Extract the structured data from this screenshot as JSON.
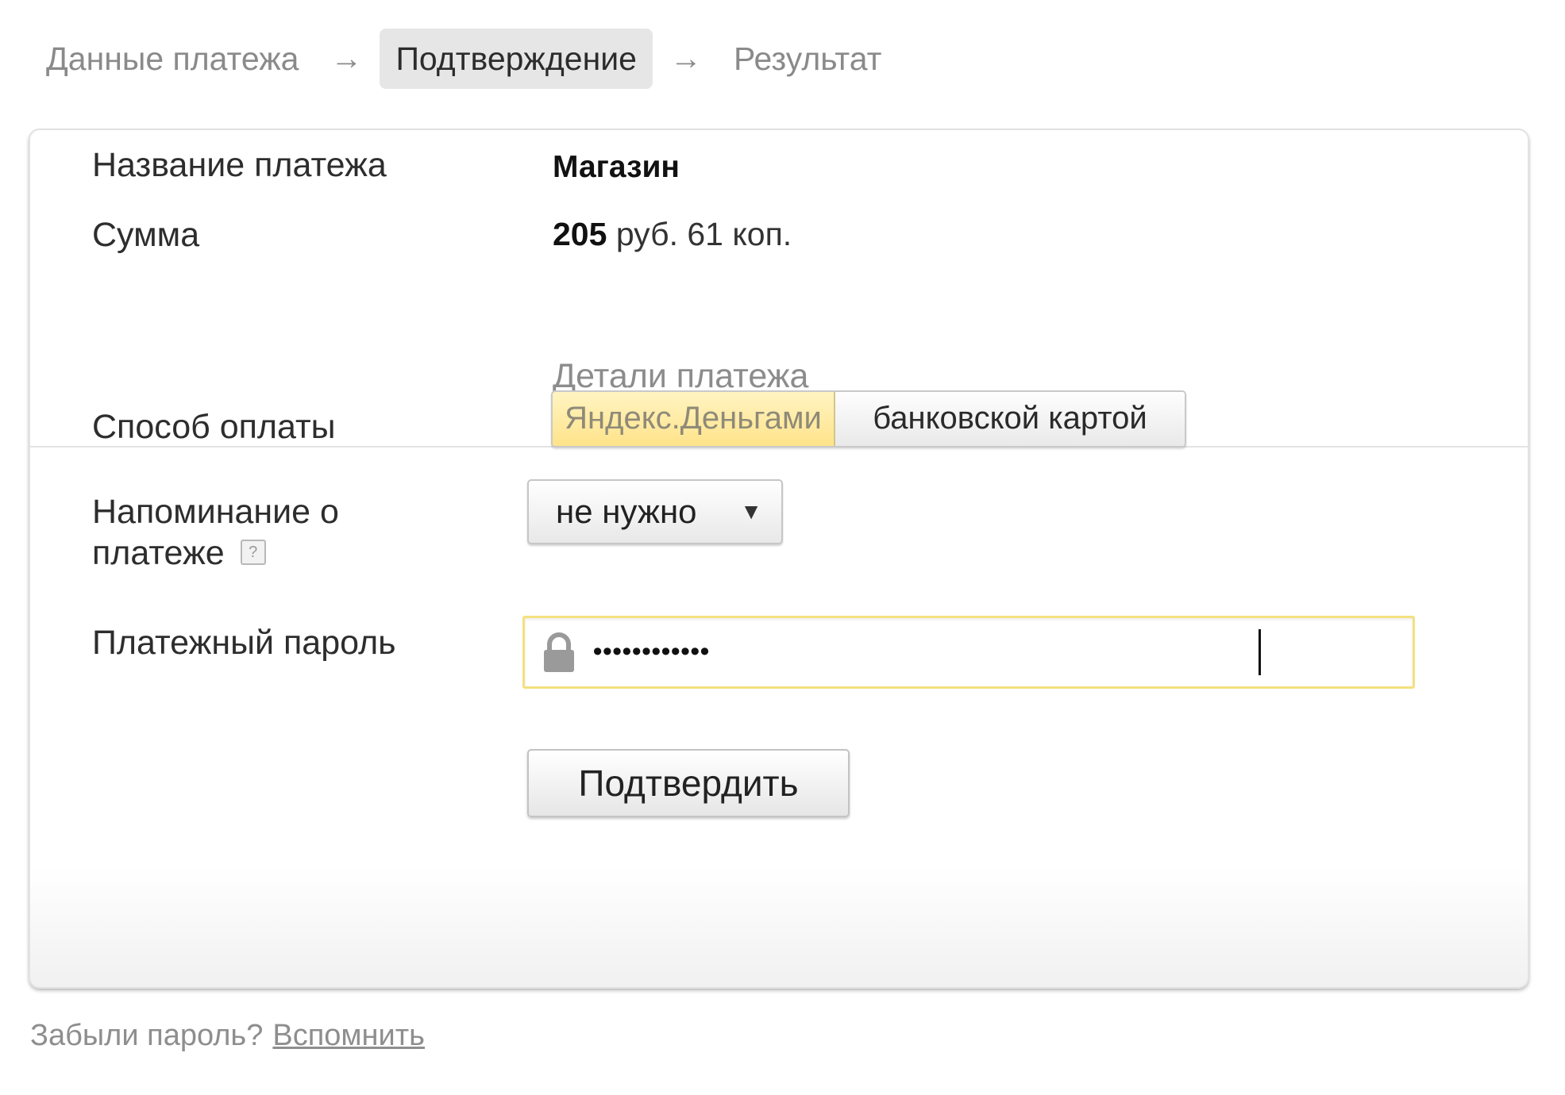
{
  "breadcrumb": {
    "step1": "Данные платежа",
    "arrow": "→",
    "step2": "Подтверждение",
    "step3": "Результат"
  },
  "payment": {
    "name_label": "Название платежа",
    "name_value": "Магазин",
    "sum_label": "Сумма",
    "sum_main": "205",
    "sum_rest": " руб. 61 коп.",
    "details_link": "Детали платежа"
  },
  "form": {
    "method_label": "Способ оплаты",
    "method_options": [
      "Яндекс.Деньгами",
      "банковской картой"
    ],
    "method_selected": "Яндекс.Деньгами",
    "reminder_label_line1": "Напоминание о",
    "reminder_label_line2": "платеже",
    "reminder_help": "?",
    "reminder_value": "не нужно",
    "reminder_arrow": "▼",
    "password_label": "Платежный пароль",
    "password_value": "••••••••••••",
    "submit_label": "Подтвердить"
  },
  "footer": {
    "question": "Забыли пароль?",
    "link": "Вспомнить"
  },
  "colors": {
    "selected_segment": "#ffe38a",
    "password_focus_border": "#f4e07e",
    "breadcrumb_active_bg": "#e6e6e6"
  },
  "icons": {
    "lock": "lock-icon",
    "help": "help-icon",
    "dropdown": "triangle-down-icon"
  }
}
